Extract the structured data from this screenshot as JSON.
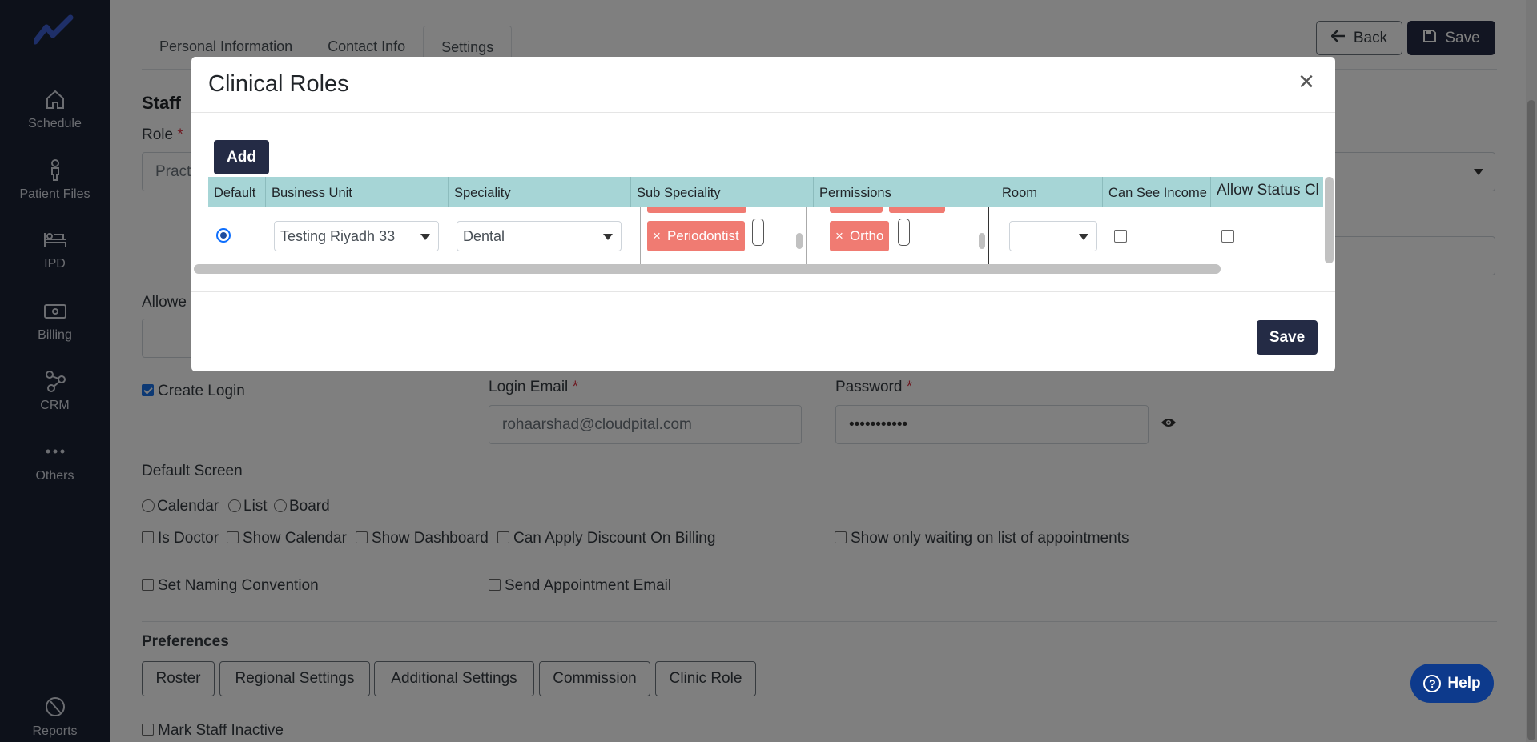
{
  "sidebar": {
    "logo": "logo-icon",
    "items": [
      {
        "label": "Schedule",
        "icon": "home-icon"
      },
      {
        "label": "Patient Files",
        "icon": "person-icon"
      },
      {
        "label": "IPD",
        "icon": "bed-icon"
      },
      {
        "label": "Billing",
        "icon": "money-icon"
      },
      {
        "label": "CRM",
        "icon": "network-icon"
      },
      {
        "label": "Others",
        "icon": "dots-icon"
      },
      {
        "label": "Reports",
        "icon": "pie-chart-icon"
      }
    ]
  },
  "tabs": [
    {
      "label": "Personal Information",
      "active": false
    },
    {
      "label": "Contact Info",
      "active": false
    },
    {
      "label": "Settings",
      "active": true
    }
  ],
  "toolbar": {
    "back_label": "Back",
    "save_label": "Save"
  },
  "form": {
    "section_title": "Staff",
    "role_label": "Role",
    "role_value": "Pract",
    "allowed_label": "Allowe",
    "create_login_label": "Create Login",
    "login_email_label": "Login Email",
    "login_email_value": "rohaarshad@cloudpital.com",
    "password_label": "Password",
    "password_value": "•••••••••••",
    "default_screen_label": "Default Screen",
    "screens": [
      "Calendar",
      "List",
      "Board"
    ],
    "options_row1": [
      "Is Doctor",
      "Show Calendar",
      "Show Dashboard",
      "Can Apply Discount On Billing"
    ],
    "option_waiting": "Show only waiting on list of appointments",
    "option_naming": "Set Naming Convention",
    "option_send_email": "Send Appointment Email",
    "preferences_label": "Preferences",
    "preferences": [
      "Roster",
      "Regional Settings",
      "Additional Settings",
      "Commission",
      "Clinic Role"
    ],
    "inactive_label": "Mark Staff Inactive"
  },
  "help": {
    "label": "Help"
  },
  "modal": {
    "title": "Clinical Roles",
    "add_label": "Add",
    "save_label": "Save",
    "columns": [
      "Default",
      "Business Unit",
      "Speciality",
      "Sub Speciality",
      "Permissions",
      "Room",
      "Can See Income",
      "Allow Status Cl"
    ],
    "row": {
      "business_unit": "Testing Riyadh 33",
      "speciality": "Dental",
      "sub_speciality_chip": "Periodontist",
      "permission_chip": "Ortho",
      "remove_symbol": "×"
    }
  },
  "colors": {
    "sidebar_bg": "#1b2235",
    "primary_button": "#242b45",
    "table_header": "#a6d5d6",
    "chip": "#f07b72",
    "help_button": "#0d3a8c"
  }
}
